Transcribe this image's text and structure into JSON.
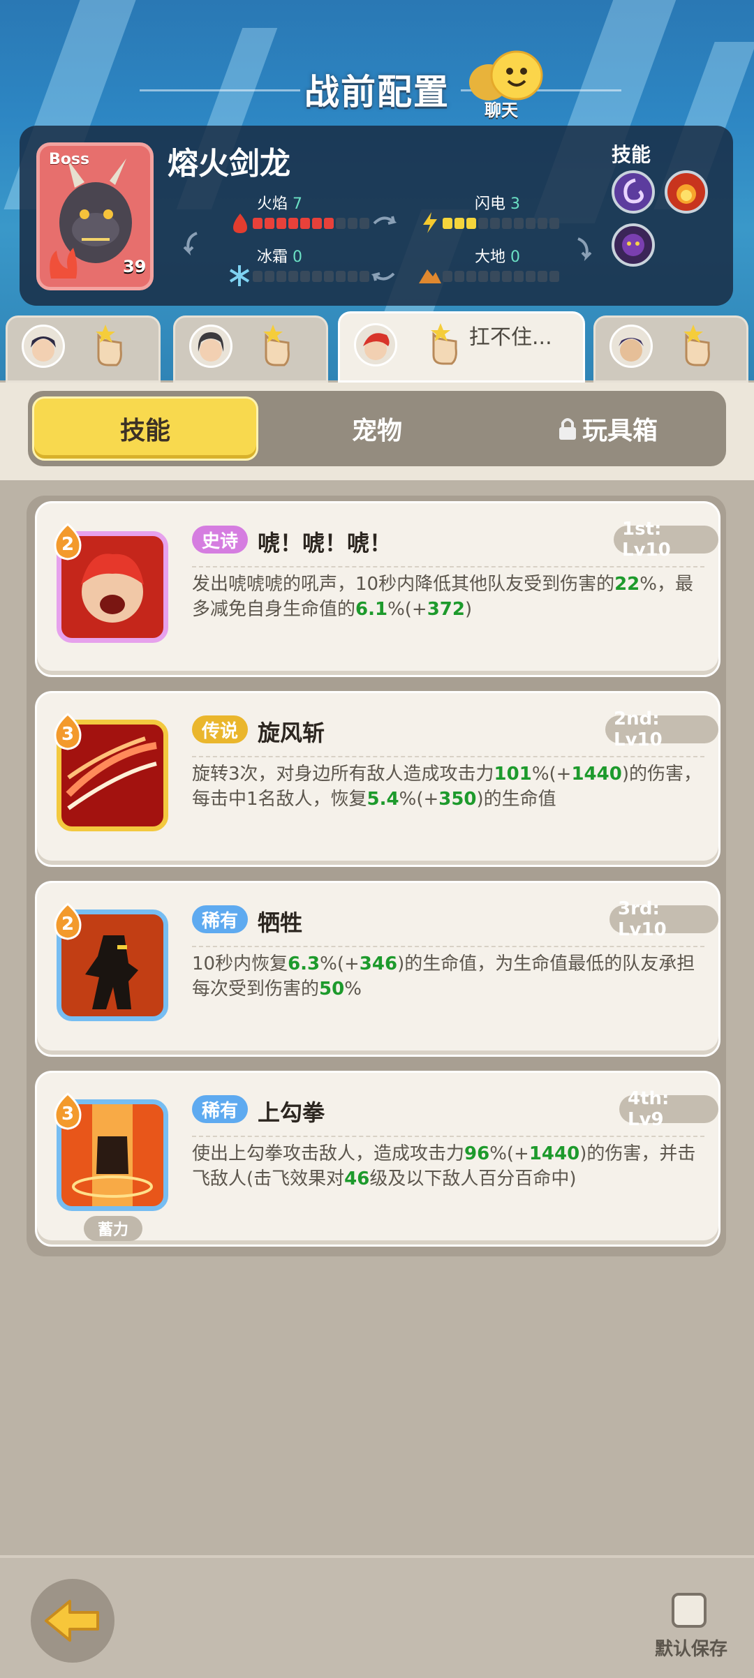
{
  "header": {
    "title": "战前配置",
    "chat_label": "聊天"
  },
  "boss": {
    "tag": "Boss",
    "name": "熔火剑龙",
    "level": "39",
    "elements": [
      {
        "label": "火焰",
        "value": "7",
        "max": 10
      },
      {
        "label": "闪电",
        "value": "3",
        "max": 10
      },
      {
        "label": "冰霜",
        "value": "0",
        "max": 10
      },
      {
        "label": "大地",
        "value": "0",
        "max": 10
      }
    ],
    "skills_label": "技能",
    "skill_icons": [
      "vortex-icon",
      "fireball-icon",
      "demon-face-icon"
    ]
  },
  "heroes": {
    "active_status": "扛不住..."
  },
  "tabs": {
    "skills": "技能",
    "pets": "宠物",
    "toys": "玩具箱"
  },
  "skills": [
    {
      "level": "2",
      "rarity": "史诗",
      "rarity_color": "#d57de0",
      "name": "唬！唬！唬！",
      "slot": "1st: Lv10",
      "desc": [
        [
          "发出唬唬唬的吼声，10秒内降低其他队友受到伤害的",
          "n"
        ],
        [
          "22",
          "g"
        ],
        [
          "%，最多减免自身生命值的",
          "n"
        ],
        [
          "6.1",
          "g"
        ],
        [
          "%(+",
          "n"
        ],
        [
          "372",
          "g"
        ],
        [
          ")",
          "n"
        ]
      ]
    },
    {
      "level": "3",
      "rarity": "传说",
      "rarity_color": "#eab62c",
      "name": "旋风斩",
      "slot": "2nd: Lv10",
      "desc": [
        [
          "旋转3次，对身边所有敌人造成攻击力",
          "n"
        ],
        [
          "101",
          "g"
        ],
        [
          "%(+",
          "n"
        ],
        [
          "1440",
          "g"
        ],
        [
          ")的伤害，每击中1名敌人，恢复",
          "n"
        ],
        [
          "5.4",
          "g"
        ],
        [
          "%(+",
          "n"
        ],
        [
          "350",
          "g"
        ],
        [
          ")的生命值",
          "n"
        ]
      ]
    },
    {
      "level": "2",
      "rarity": "稀有",
      "rarity_color": "#5eaaf0",
      "name": "牺牲",
      "slot": "3rd: Lv10",
      "desc": [
        [
          "10秒内恢复",
          "n"
        ],
        [
          "6.3",
          "g"
        ],
        [
          "%(+",
          "n"
        ],
        [
          "346",
          "g"
        ],
        [
          ")的生命值，为生命值最低的队友承担每次受到伤害的",
          "n"
        ],
        [
          "50",
          "g"
        ],
        [
          "%",
          "n"
        ]
      ]
    },
    {
      "level": "3",
      "rarity": "稀有",
      "rarity_color": "#5eaaf0",
      "name": "上勾拳",
      "slot": "4th: Lv9",
      "desc": [
        [
          "使出上勾拳攻击敌人，造成攻击力",
          "n"
        ],
        [
          "96",
          "g"
        ],
        [
          "%(+",
          "n"
        ],
        [
          "1440",
          "g"
        ],
        [
          ")的伤害，并击飞敌人(击飞效果对",
          "n"
        ],
        [
          "46",
          "g"
        ],
        [
          "级及以下敌人百分百命中)",
          "n"
        ]
      ]
    }
  ],
  "charge_tag": "蓄力",
  "footer": {
    "save_label": "默认保存"
  }
}
